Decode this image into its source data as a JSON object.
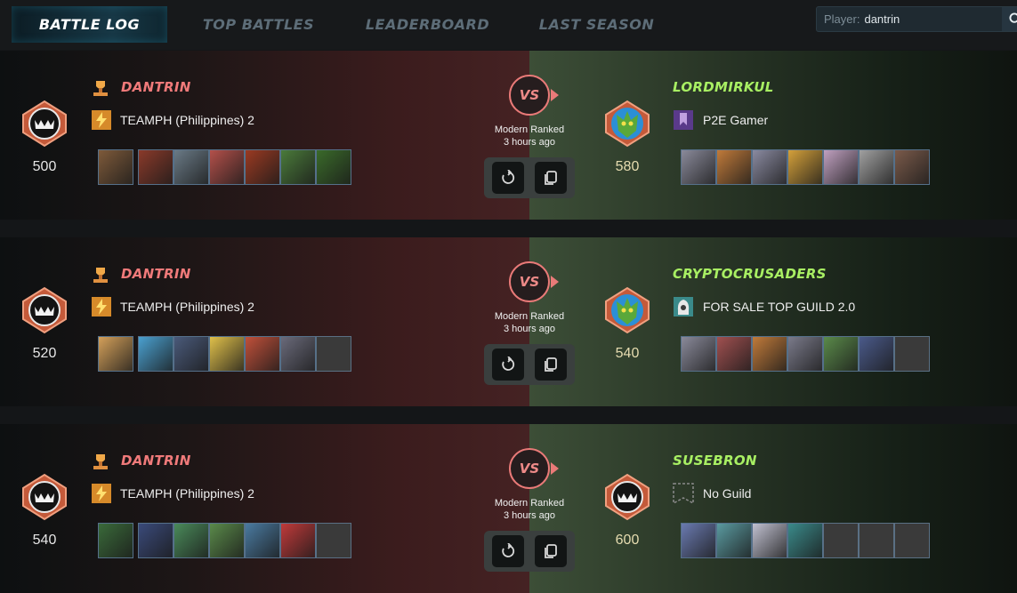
{
  "tabs": [
    {
      "label": "BATTLE LOG",
      "active": true
    },
    {
      "label": "TOP BATTLES",
      "active": false
    },
    {
      "label": "LEADERBOARD",
      "active": false
    },
    {
      "label": "LAST SEASON",
      "active": false
    }
  ],
  "search": {
    "label": "Player:",
    "value": "dantrin"
  },
  "colors": {
    "player_name": "#f07a7a",
    "opponent_name": "#a8ef63",
    "vs_accent": "#e97a78"
  },
  "battles": [
    {
      "mode": "Modern Ranked",
      "time": "3 hours ago",
      "vs_label": "VS",
      "player": {
        "name": "DANTRIN",
        "guild": "TEAMPH (Philippines) 2",
        "rating": "500",
        "badge": "monster-badge-icon",
        "cards_filled": 7
      },
      "opponent": {
        "name": "LORDMIRKUL",
        "guild": "P2E Gamer",
        "rating": "580",
        "badge": "dragon-badge-icon",
        "cards_filled": 7
      }
    },
    {
      "mode": "Modern Ranked",
      "time": "3 hours ago",
      "vs_label": "VS",
      "player": {
        "name": "DANTRIN",
        "guild": "TEAMPH (Philippines) 2",
        "rating": "520",
        "badge": "monster-badge-icon",
        "cards_filled": 6
      },
      "opponent": {
        "name": "CRYPTOCRUSADERS",
        "guild": "FOR SALE TOP GUILD 2.0",
        "rating": "540",
        "badge": "dragon-badge-icon",
        "cards_filled": 6
      }
    },
    {
      "mode": "Modern Ranked",
      "time": "3 hours ago",
      "vs_label": "VS",
      "player": {
        "name": "DANTRIN",
        "guild": "TEAMPH (Philippines) 2",
        "rating": "540",
        "badge": "monster-badge-icon",
        "cards_filled": 6
      },
      "opponent": {
        "name": "SUSEBRON",
        "guild": "No Guild",
        "rating": "600",
        "badge": "monster-badge-icon",
        "cards_filled": 4
      }
    }
  ]
}
